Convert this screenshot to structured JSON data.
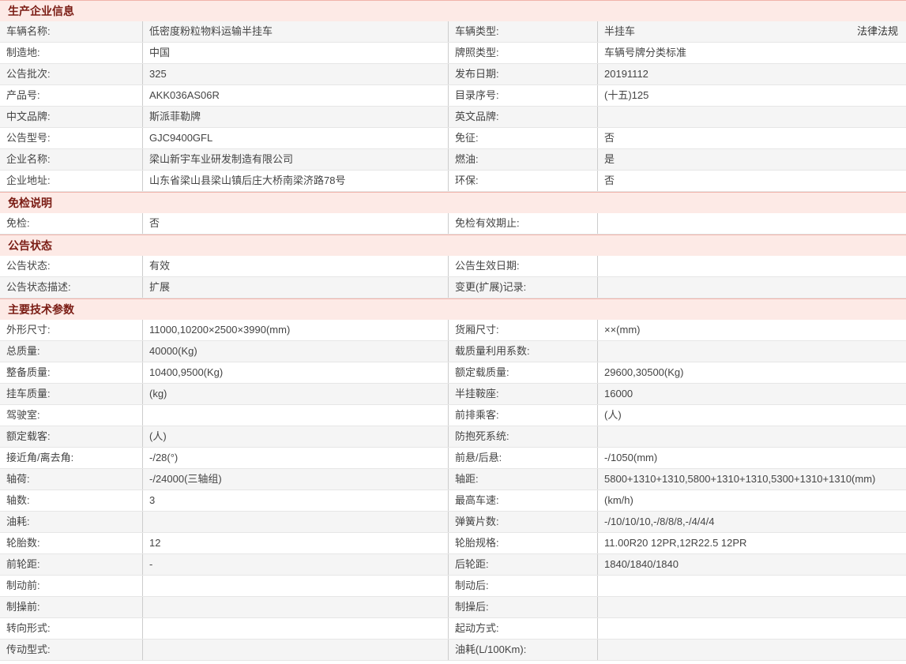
{
  "colors": {
    "section_header_bg": "#fdeae6",
    "section_header_text": "#7a1c14",
    "section_header_top_border": "#f0b3aa",
    "row_alt_bg": "#f5f5f5",
    "cell_border": "#cccccc",
    "text": "#444444"
  },
  "sections": [
    {
      "title": "生产企业信息",
      "rows": [
        {
          "label": "车辆名称:",
          "value": "低密度粉粒物料运输半挂车",
          "label2": "车辆类型:",
          "value2": "半挂车",
          "legal_link": "法律法规"
        },
        {
          "label": "制造地:",
          "value": "中国",
          "label2": "牌照类型:",
          "value2": "车辆号牌分类标准"
        },
        {
          "label": "公告批次:",
          "value": "325",
          "label2": "发布日期:",
          "value2": "20191112"
        },
        {
          "label": "产品号:",
          "value": "AKK036AS06R",
          "label2": "目录序号:",
          "value2": "(十五)125"
        },
        {
          "label": "中文品牌:",
          "value": "斯派菲勒牌",
          "label2": "英文品牌:",
          "value2": ""
        },
        {
          "label": "公告型号:",
          "value": "GJC9400GFL",
          "label2": "免征:",
          "value2": "否"
        },
        {
          "label": "企业名称:",
          "value": "梁山新宇车业研发制造有限公司",
          "label2": "燃油:",
          "value2": "是"
        },
        {
          "label": "企业地址:",
          "value": "山东省梁山县梁山镇后庄大桥南梁济路78号",
          "label2": "环保:",
          "value2": "否"
        }
      ]
    },
    {
      "title": "免检说明",
      "rows": [
        {
          "label": "免检:",
          "value": "否",
          "label2": "免检有效期止:",
          "value2": ""
        }
      ]
    },
    {
      "title": "公告状态",
      "rows": [
        {
          "label": "公告状态:",
          "value": "有效",
          "label2": "公告生效日期:",
          "value2": ""
        },
        {
          "label": "公告状态描述:",
          "value": "扩展",
          "label2": "变更(扩展)记录:",
          "value2": ""
        }
      ]
    },
    {
      "title": "主要技术参数",
      "rows": [
        {
          "label": "外形尺寸:",
          "value": "11000,10200×2500×3990(mm)",
          "label2": "货厢尺寸:",
          "value2": "××(mm)"
        },
        {
          "label": "总质量:",
          "value": "40000(Kg)",
          "label2": "载质量利用系数:",
          "value2": ""
        },
        {
          "label": "整备质量:",
          "value": "10400,9500(Kg)",
          "label2": "额定载质量:",
          "value2": "29600,30500(Kg)"
        },
        {
          "label": "挂车质量:",
          "value": "(kg)",
          "label2": "半挂鞍座:",
          "value2": "16000"
        },
        {
          "label": "驾驶室:",
          "value": "",
          "label2": "前排乘客:",
          "value2": "(人)"
        },
        {
          "label": "额定载客:",
          "value": "(人)",
          "label2": "防抱死系统:",
          "value2": ""
        },
        {
          "label": "接近角/离去角:",
          "value": "-/28(°)",
          "label2": "前悬/后悬:",
          "value2": "-/1050(mm)"
        },
        {
          "label": "轴荷:",
          "value": "-/24000(三轴组)",
          "label2": "轴距:",
          "value2": "5800+1310+1310,5800+1310+1310,5300+1310+1310(mm)"
        },
        {
          "label": "轴数:",
          "value": "3",
          "label2": "最高车速:",
          "value2": "(km/h)"
        },
        {
          "label": "油耗:",
          "value": "",
          "label2": "弹簧片数:",
          "value2": "-/10/10/10,-/8/8/8,-/4/4/4"
        },
        {
          "label": "轮胎数:",
          "value": "12",
          "label2": "轮胎规格:",
          "value2": "11.00R20 12PR,12R22.5 12PR"
        },
        {
          "label": "前轮距:",
          "value": "-",
          "label2": "后轮距:",
          "value2": "1840/1840/1840"
        },
        {
          "label": "制动前:",
          "value": "",
          "label2": "制动后:",
          "value2": ""
        },
        {
          "label": "制操前:",
          "value": "",
          "label2": "制操后:",
          "value2": ""
        },
        {
          "label": "转向形式:",
          "value": "",
          "label2": "起动方式:",
          "value2": ""
        },
        {
          "label": "传动型式:",
          "value": "",
          "label2": "油耗(L/100Km):",
          "value2": ""
        }
      ]
    }
  ]
}
